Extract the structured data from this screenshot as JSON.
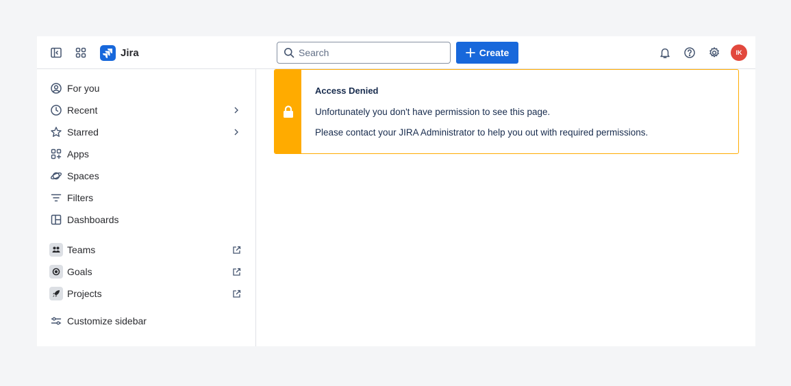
{
  "app": {
    "name": "Jira"
  },
  "topbar": {
    "search_placeholder": "Search",
    "create_label": "Create",
    "avatar_initials": "IK",
    "avatar_color": "#e2483d",
    "brand_color": "#1868db"
  },
  "sidebar": {
    "items": [
      {
        "label": "For you",
        "icon": "person-circle-icon"
      },
      {
        "label": "Recent",
        "icon": "clock-icon",
        "trailing": "chevron-right-icon"
      },
      {
        "label": "Starred",
        "icon": "star-icon",
        "trailing": "chevron-right-icon"
      },
      {
        "label": "Apps",
        "icon": "apps-icon"
      },
      {
        "label": "Spaces",
        "icon": "planet-icon"
      },
      {
        "label": "Filters",
        "icon": "filter-icon"
      },
      {
        "label": "Dashboards",
        "icon": "dashboard-icon"
      }
    ],
    "external": [
      {
        "label": "Teams",
        "icon": "teams-icon",
        "trailing": "external-link-icon"
      },
      {
        "label": "Goals",
        "icon": "goals-icon",
        "trailing": "external-link-icon"
      },
      {
        "label": "Projects",
        "icon": "rocket-icon",
        "trailing": "external-link-icon"
      }
    ],
    "customize_label": "Customize sidebar"
  },
  "banner": {
    "title": "Access Denied",
    "message": "Unfortunately you don't have permission to see this page.",
    "help": "Please contact your JIRA Administrator to help you out with required permissions.",
    "accent_color": "#ffab00",
    "icon": "lock-icon"
  }
}
